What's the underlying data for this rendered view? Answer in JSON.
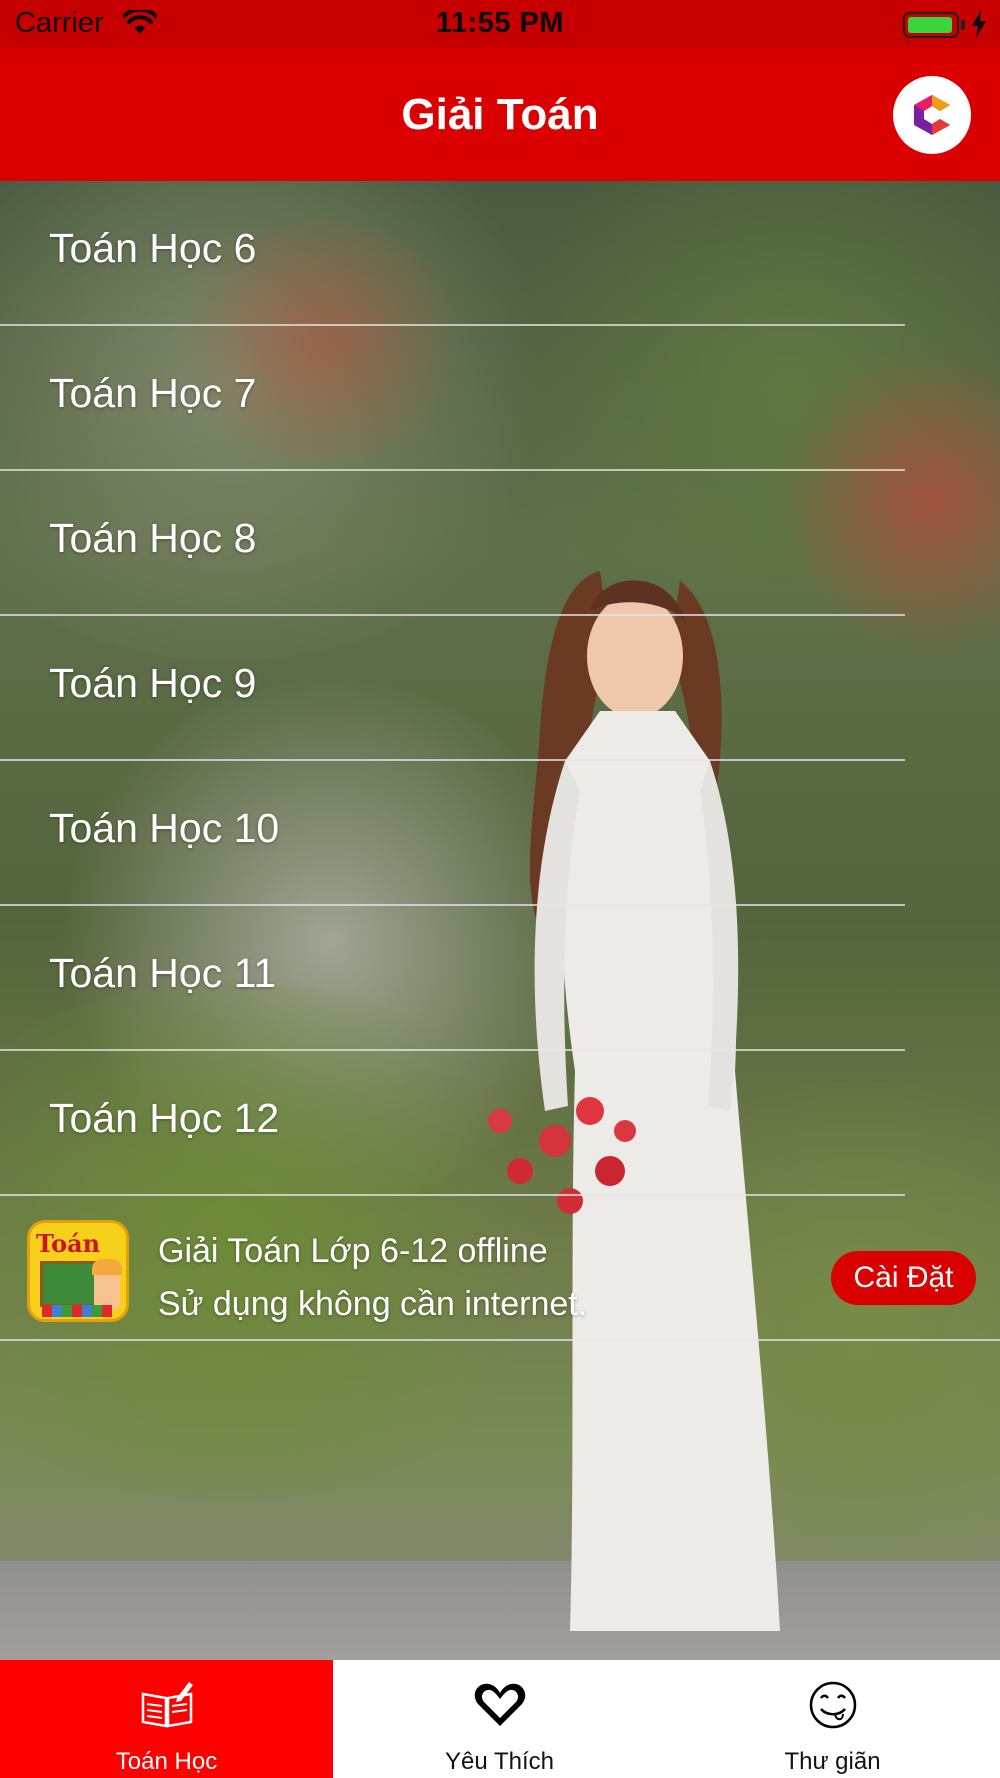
{
  "status_bar": {
    "carrier": "Carrier",
    "time": "11:55 PM",
    "battery_level": 0.95,
    "battery_color": "#3bd43b"
  },
  "nav": {
    "title": "Giải Toán",
    "logo_icon": "c-logo-icon"
  },
  "list": {
    "items": [
      {
        "label": "Toán Học 6"
      },
      {
        "label": "Toán Học 7"
      },
      {
        "label": "Toán Học 8"
      },
      {
        "label": "Toán Học 9"
      },
      {
        "label": "Toán Học 10"
      },
      {
        "label": "Toán Học 11"
      },
      {
        "label": "Toán Học 12"
      }
    ]
  },
  "promo": {
    "icon_text": "Toán",
    "line1": "Giải Toán Lớp 6-12 offline",
    "line2": "Sử dụng không cần internet.",
    "button_label": "Cài Đặt"
  },
  "tabs": [
    {
      "label": "Toán Học",
      "icon": "book-pencil-icon",
      "active": true
    },
    {
      "label": "Yêu Thích",
      "icon": "heart-icon",
      "active": false
    },
    {
      "label": "Thư giãn",
      "icon": "smiley-tongue-icon",
      "active": false
    }
  ],
  "colors": {
    "status_bar": "#c60000",
    "nav_bar": "#db0000",
    "active_tab": "#fe0000",
    "install_button": "#d90000"
  }
}
